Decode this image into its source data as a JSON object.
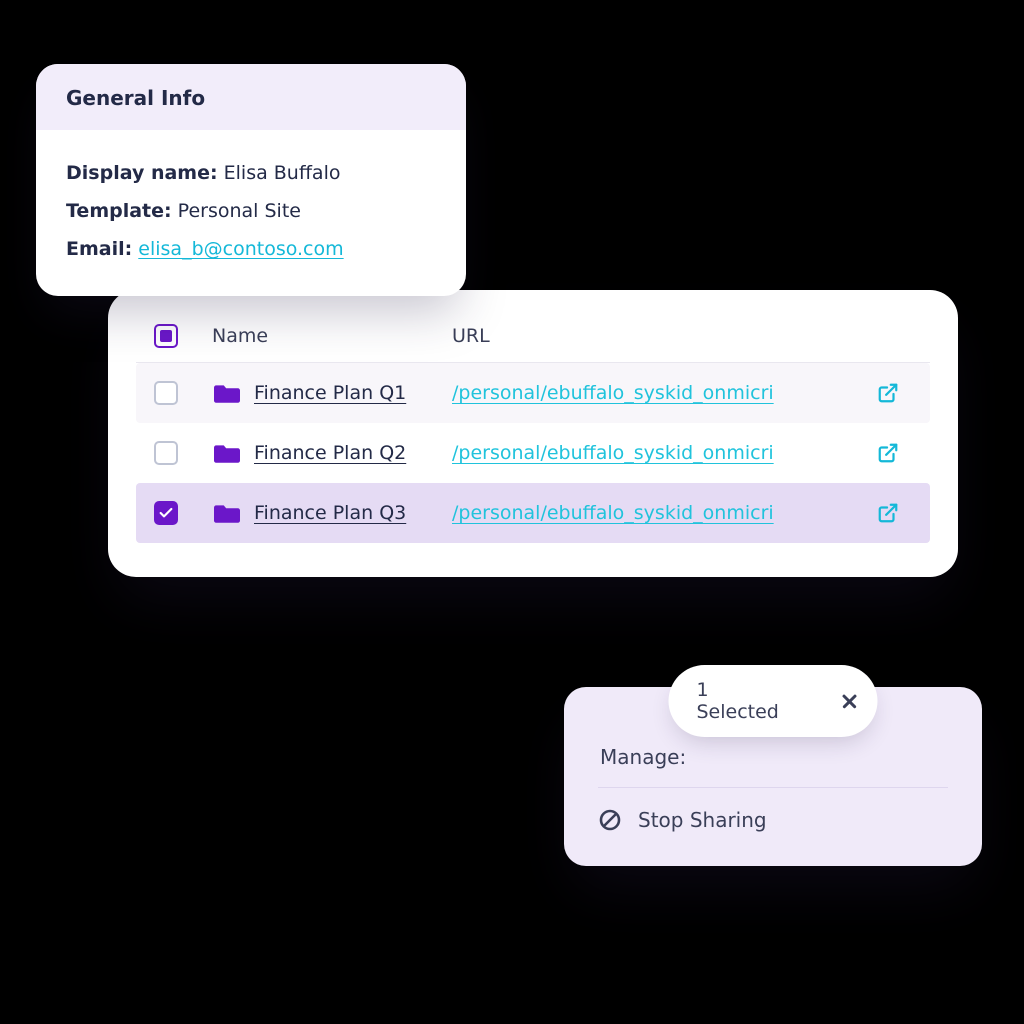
{
  "general": {
    "title": "General Info",
    "fields": {
      "display_name_label": "Display name:",
      "display_name_value": "Elisa Buffalo",
      "template_label": "Template:",
      "template_value": "Personal Site",
      "email_label": "Email:",
      "email_value": "elisa_b@contoso.com"
    }
  },
  "table": {
    "columns": {
      "name": "Name",
      "url": "URL"
    },
    "rows": [
      {
        "name": "Finance Plan Q1",
        "url": "/personal/ebuffalo_syskid_onmicri",
        "checked": false
      },
      {
        "name": "Finance Plan Q2",
        "url": "/personal/ebuffalo_syskid_onmicri",
        "checked": false
      },
      {
        "name": "Finance Plan Q3",
        "url": "/personal/ebuffalo_syskid_onmicri",
        "checked": true
      }
    ]
  },
  "selection": {
    "count_text": "1 Selected",
    "manage_label": "Manage:",
    "stop_sharing_label": "Stop Sharing"
  },
  "colors": {
    "purple": "#6b17c9",
    "cyan": "#14b8d8"
  }
}
